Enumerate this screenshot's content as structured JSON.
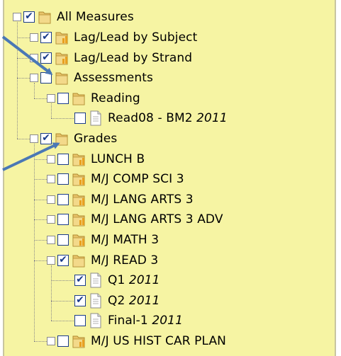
{
  "tree": [
    {
      "label": "All Measures",
      "year": "",
      "depth": 0,
      "kind": "folder",
      "expander": "−",
      "checked": true
    },
    {
      "label": "Lag/Lead by Subject",
      "year": "",
      "depth": 1,
      "kind": "bar-folder",
      "expander": "+",
      "checked": true
    },
    {
      "label": "Lag/Lead by Strand",
      "year": "",
      "depth": 1,
      "kind": "bar-folder",
      "expander": "+",
      "checked": true
    },
    {
      "label": "Assessments",
      "year": "",
      "depth": 1,
      "kind": "folder",
      "expander": "−",
      "checked": false
    },
    {
      "label": "Reading",
      "year": "",
      "depth": 2,
      "kind": "folder",
      "expander": "−",
      "checked": false
    },
    {
      "label": "Read08 - BM2 ",
      "year": "2011",
      "depth": 3,
      "kind": "document",
      "expander": "",
      "checked": false
    },
    {
      "label": "Grades",
      "year": "",
      "depth": 1,
      "kind": "folder",
      "expander": "−",
      "checked": true
    },
    {
      "label": "LUNCH B",
      "year": "",
      "depth": 2,
      "kind": "bar-folder",
      "expander": "+",
      "checked": false
    },
    {
      "label": "M/J COMP SCI 3",
      "year": "",
      "depth": 2,
      "kind": "bar-folder",
      "expander": "+",
      "checked": false
    },
    {
      "label": "M/J LANG ARTS 3",
      "year": "",
      "depth": 2,
      "kind": "bar-folder",
      "expander": "+",
      "checked": false
    },
    {
      "label": "M/J LANG ARTS 3 ADV",
      "year": "",
      "depth": 2,
      "kind": "bar-folder",
      "expander": "+",
      "checked": false
    },
    {
      "label": "M/J MATH 3",
      "year": "",
      "depth": 2,
      "kind": "bar-folder",
      "expander": "+",
      "checked": false
    },
    {
      "label": "M/J READ 3",
      "year": "",
      "depth": 2,
      "kind": "folder",
      "expander": "−",
      "checked": true
    },
    {
      "label": "Q1 ",
      "year": "2011",
      "depth": 3,
      "kind": "document",
      "expander": "",
      "checked": true
    },
    {
      "label": "Q2 ",
      "year": "2011",
      "depth": 3,
      "kind": "document",
      "expander": "",
      "checked": true
    },
    {
      "label": "Final-1 ",
      "year": "2011",
      "depth": 3,
      "kind": "document",
      "expander": "",
      "checked": false
    },
    {
      "label": "M/J US HIST CAR PLAN",
      "year": "",
      "depth": 2,
      "kind": "bar-folder",
      "expander": "+",
      "checked": false
    }
  ],
  "colors": {
    "panel_background": "#f6f4a3",
    "arrow": "#4a78b5",
    "checkbox_border": "#1a3b8a",
    "folder": "#e8c46a",
    "bar_orange": "#e8a020"
  },
  "icons": {
    "folder": "folder-icon",
    "bar-folder": "bar-chart-folder-icon",
    "document": "document-icon"
  }
}
